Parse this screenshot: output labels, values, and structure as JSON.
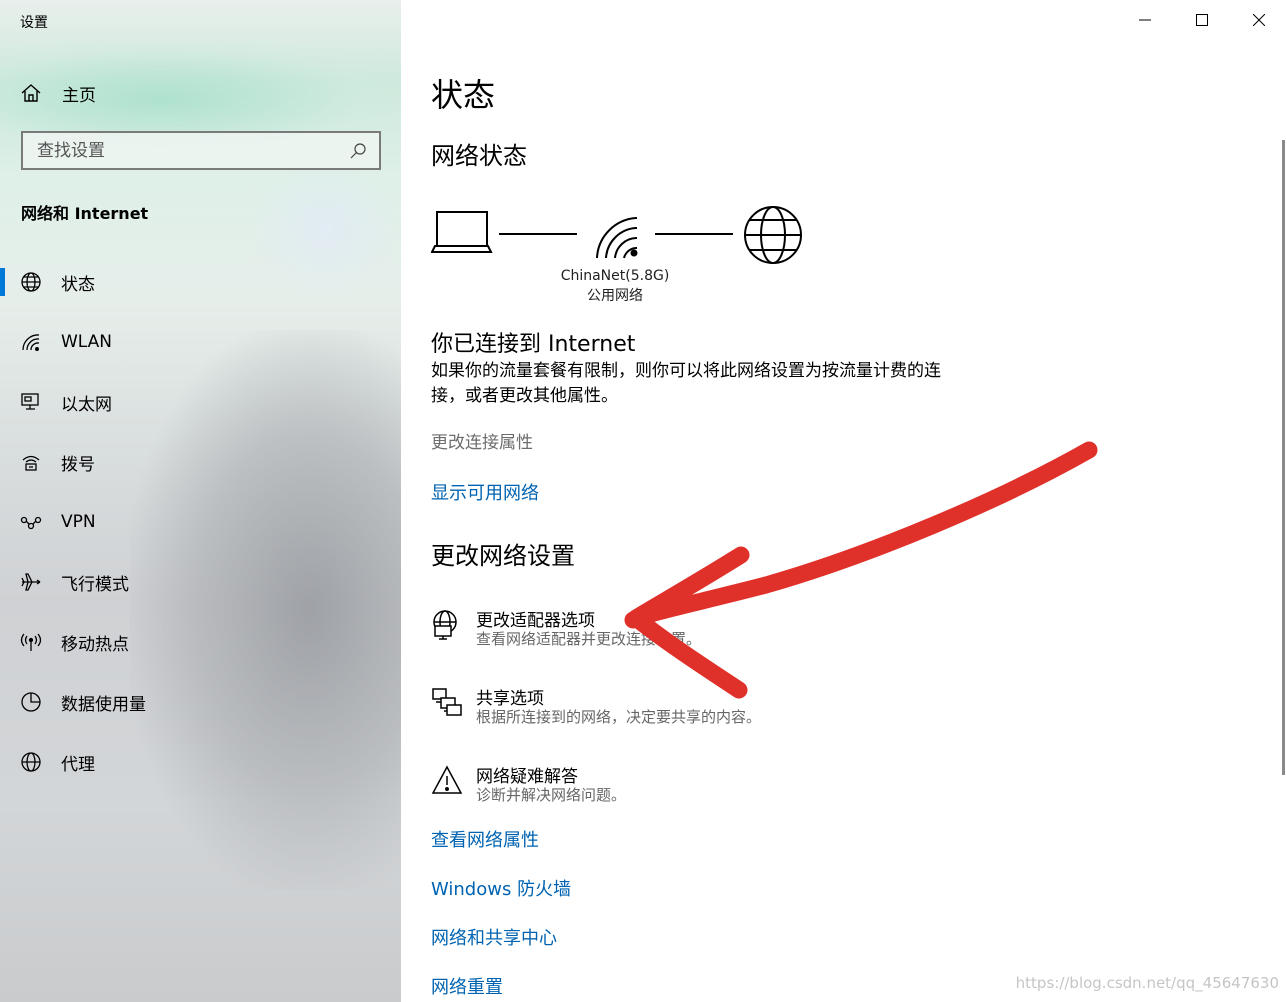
{
  "window": {
    "title": "设置",
    "controls": [
      "minimize",
      "maximize",
      "close"
    ]
  },
  "sidebar": {
    "home_label": "主页",
    "search_placeholder": "查找设置",
    "section_title": "网络和 Internet",
    "items": [
      {
        "label": "状态",
        "icon": "globe-status-icon",
        "active": true
      },
      {
        "label": "WLAN",
        "icon": "wifi-icon",
        "active": false
      },
      {
        "label": "以太网",
        "icon": "ethernet-icon",
        "active": false
      },
      {
        "label": "拨号",
        "icon": "dialup-icon",
        "active": false
      },
      {
        "label": "VPN",
        "icon": "vpn-icon",
        "active": false
      },
      {
        "label": "飞行模式",
        "icon": "airplane-icon",
        "active": false
      },
      {
        "label": "移动热点",
        "icon": "hotspot-icon",
        "active": false
      },
      {
        "label": "数据使用量",
        "icon": "data-usage-icon",
        "active": false
      },
      {
        "label": "代理",
        "icon": "globe-icon",
        "active": false
      }
    ]
  },
  "main": {
    "page_title": "状态",
    "network_status_heading": "网络状态",
    "network": {
      "name": "ChinaNet(5.8G)",
      "type": "公用网络"
    },
    "connected_title": "你已连接到 Internet",
    "connected_desc": "如果你的流量套餐有限制，则你可以将此网络设置为按流量计费的连接，或者更改其他属性。",
    "change_connection_properties": "更改连接属性",
    "show_available_networks": "显示可用网络",
    "change_settings_heading": "更改网络设置",
    "options": [
      {
        "title": "更改适配器选项",
        "subtitle": "查看网络适配器并更改连接设置。",
        "icon": "adapter-icon"
      },
      {
        "title": "共享选项",
        "subtitle": "根据所连接到的网络，决定要共享的内容。",
        "icon": "sharing-icon"
      },
      {
        "title": "网络疑难解答",
        "subtitle": "诊断并解决网络问题。",
        "icon": "warning-icon"
      }
    ],
    "links": [
      "查看网络属性",
      "Windows 防火墙",
      "网络和共享中心",
      "网络重置"
    ],
    "watermark": "https://blog.csdn.net/qq_45647630"
  },
  "colors": {
    "accent": "#0078d7",
    "link": "#0063b1",
    "annotation_arrow": "#e0302a"
  }
}
